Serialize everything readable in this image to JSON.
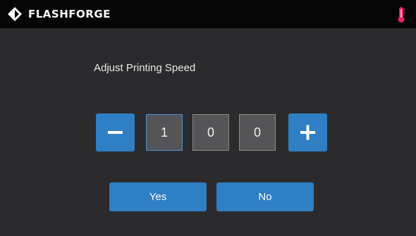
{
  "header": {
    "brand": "FLASHFORGE",
    "logo_icon": "flashforge-diamond-icon",
    "status_icon": "thermometer-icon",
    "status_color": "#e0245e"
  },
  "dialog": {
    "title": "Adjust Printing Speed",
    "digits": [
      "1",
      "0",
      "0"
    ],
    "decrease_icon": "minus-icon",
    "increase_icon": "plus-icon",
    "yes_label": "Yes",
    "no_label": "No"
  },
  "colors": {
    "accent": "#2e7fc4",
    "background": "#2b2b2e",
    "topbar": "#050505"
  }
}
